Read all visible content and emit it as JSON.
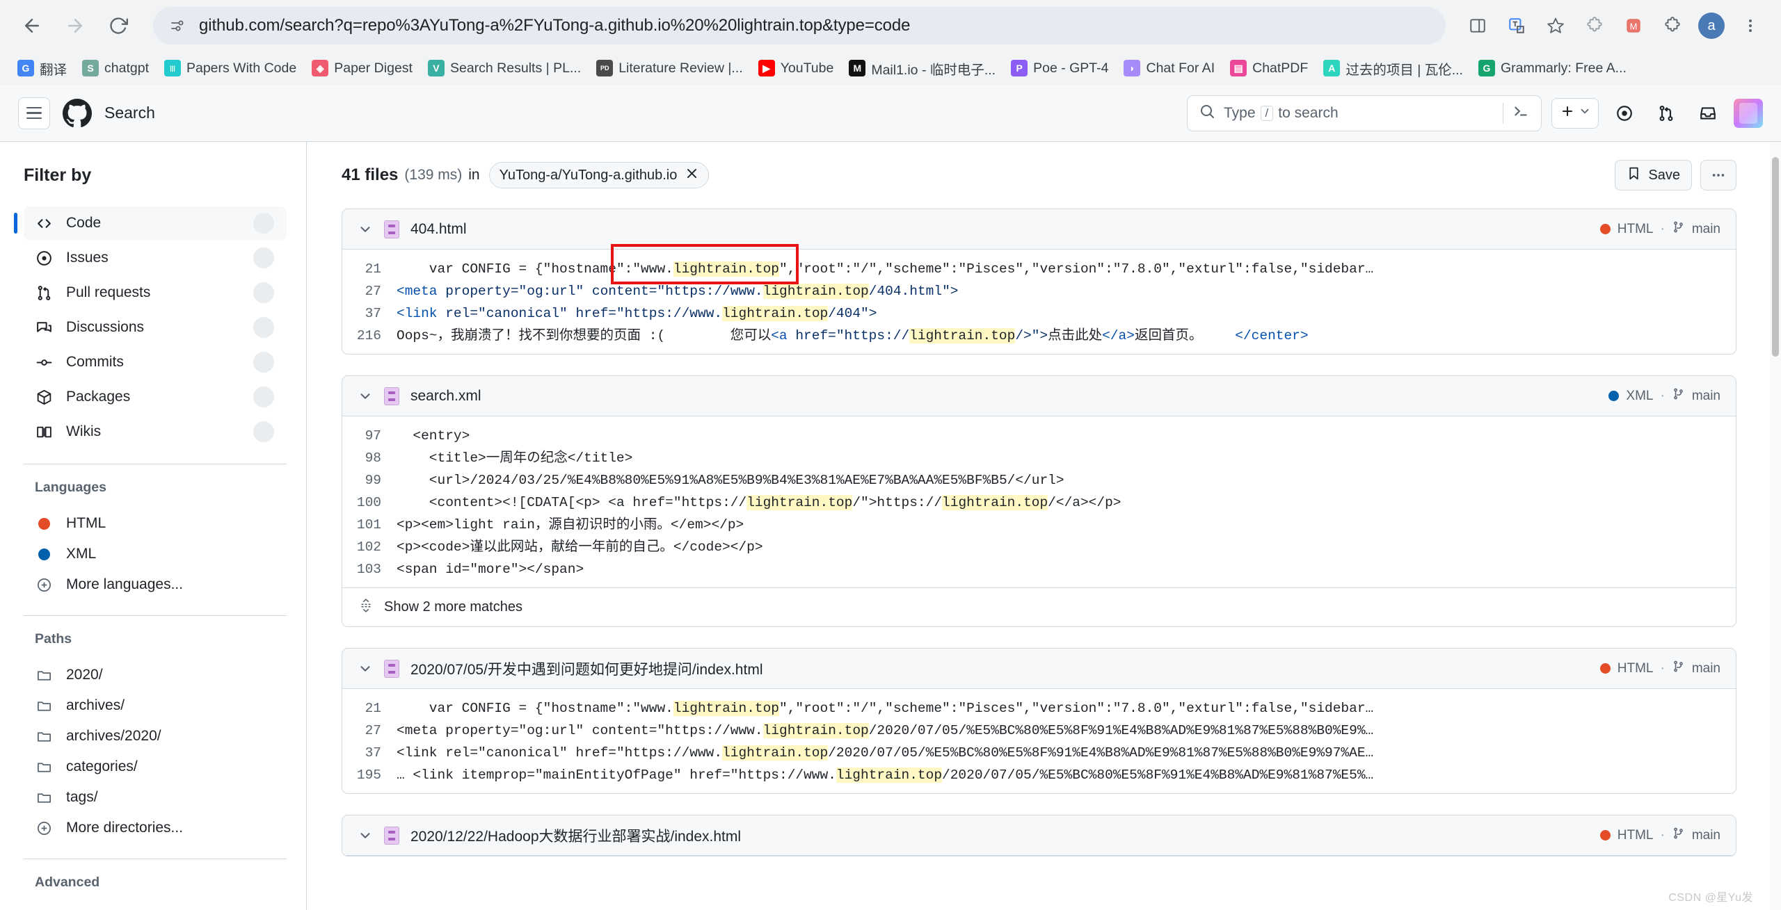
{
  "browser": {
    "url": "github.com/search?q=repo%3AYuTong-a%2FYuTong-a.github.io%20%20lightrain.top&type=code",
    "back_icon": "back-arrow-icon",
    "forward_icon": "forward-arrow-icon",
    "reload_icon": "reload-icon",
    "site_info_icon": "site-settings-icon",
    "profile_initial": "a",
    "bookmarks": [
      {
        "label": "翻译",
        "icon": "google-translate-icon",
        "color": "#4285f4",
        "glyph": "G"
      },
      {
        "label": "chatgpt",
        "icon": "chatgpt-icon",
        "color": "#74aa9c",
        "glyph": "S"
      },
      {
        "label": "Papers With Code",
        "icon": "papers-with-code-icon",
        "color": "#21cbce",
        "glyph": "|||"
      },
      {
        "label": "Paper Digest",
        "icon": "paper-digest-icon",
        "color": "#ef5a6f",
        "glyph": "◈"
      },
      {
        "label": "Search Results | PL...",
        "icon": "search-results-icon",
        "color": "#3ab0a2",
        "glyph": "V"
      },
      {
        "label": "Literature Review |...",
        "icon": "literature-review-icon",
        "color": "#4a4a4a",
        "glyph": "PD"
      },
      {
        "label": "YouTube",
        "icon": "youtube-icon",
        "color": "#ff0000",
        "glyph": "▶"
      },
      {
        "label": "Mail1.io - 临时电子...",
        "icon": "mail1-icon",
        "color": "#111111",
        "glyph": "M"
      },
      {
        "label": "Poe - GPT-4",
        "icon": "poe-icon",
        "color": "#8b5cf6",
        "glyph": "P"
      },
      {
        "label": "Chat For AI",
        "icon": "chat-for-ai-icon",
        "color": "#a78bfa",
        "glyph": "◗"
      },
      {
        "label": "ChatPDF",
        "icon": "chatpdf-icon",
        "color": "#ec4899",
        "glyph": "▤"
      },
      {
        "label": "过去的项目 | 瓦伦...",
        "icon": "past-projects-icon",
        "color": "#2dd4bf",
        "glyph": "A"
      },
      {
        "label": "Grammarly: Free A...",
        "icon": "grammarly-icon",
        "color": "#15a46e",
        "glyph": "G"
      }
    ]
  },
  "gh_header": {
    "title": "Search",
    "search_placeholder_pre": "Type",
    "search_key": "/",
    "search_placeholder_post": "to search",
    "menu_icon": "hamburger-menu-icon",
    "logo_icon": "github-logo-icon",
    "command_palette_icon": "command-palette-icon",
    "create_new_icon": "plus-icon",
    "issues_icon": "issues-icon",
    "pull_requests_icon": "pull-request-icon",
    "notifications_icon": "inbox-icon",
    "avatar_icon": "user-avatar"
  },
  "sidebar": {
    "title": "Filter by",
    "items": [
      {
        "label": "Code",
        "icon": "code-icon",
        "active": true
      },
      {
        "label": "Issues",
        "icon": "issue-opened-icon",
        "active": false
      },
      {
        "label": "Pull requests",
        "icon": "git-pull-request-icon",
        "active": false
      },
      {
        "label": "Discussions",
        "icon": "comment-discussion-icon",
        "active": false
      },
      {
        "label": "Commits",
        "icon": "git-commit-icon",
        "active": false
      },
      {
        "label": "Packages",
        "icon": "package-icon",
        "active": false
      },
      {
        "label": "Wikis",
        "icon": "book-icon",
        "active": false
      }
    ],
    "languages_heading": "Languages",
    "languages": [
      {
        "label": "HTML",
        "color": "#e34c26"
      },
      {
        "label": "XML",
        "color": "#0060ac"
      }
    ],
    "more_languages": "More languages...",
    "paths_heading": "Paths",
    "paths": [
      {
        "label": "2020/"
      },
      {
        "label": "archives/"
      },
      {
        "label": "archives/2020/"
      },
      {
        "label": "categories/"
      },
      {
        "label": "tags/"
      }
    ],
    "more_directories": "More directories...",
    "advanced_heading": "Advanced"
  },
  "results": {
    "count_label": "41 files",
    "time_label": "(139 ms)",
    "in_label": "in",
    "repo_chip": "YuTong-a/YuTong-a.github.io",
    "repo_chip_remove_icon": "close-icon",
    "save_label": "Save",
    "save_icon": "bookmark-icon",
    "more_actions_icon": "kebab-icon",
    "cards": [
      {
        "file_name": "404.html",
        "file_icon": "html-file-icon",
        "language": "HTML",
        "language_color": "#e34c26",
        "branch": "main",
        "branch_icon": "git-branch-icon",
        "chevron_icon": "chevron-down-icon",
        "lines": [
          {
            "num": "21",
            "segments": [
              {
                "t": "    var CONFIG = {\"hostname\":\"www.",
                "c": "plain"
              },
              {
                "t": "lightrain.top",
                "c": "hl"
              },
              {
                "t": "\",\"root\":\"/\",\"scheme\":\"Pisces\",\"version\":\"7.8.0\",\"exturl\":false,\"sidebar…",
                "c": "plain"
              }
            ]
          },
          {
            "num": "27",
            "segments": [
              {
                "t": "<meta ",
                "c": "tag"
              },
              {
                "t": "property=",
                "c": "attr"
              },
              {
                "t": "\"og:url\" ",
                "c": "str"
              },
              {
                "t": "content=",
                "c": "attr"
              },
              {
                "t": "\"https://www.",
                "c": "str"
              },
              {
                "t": "lightrain.top",
                "c": "hl"
              },
              {
                "t": "/404.html\">",
                "c": "str"
              }
            ]
          },
          {
            "num": "37",
            "segments": [
              {
                "t": "<link ",
                "c": "tag"
              },
              {
                "t": "rel=",
                "c": "attr"
              },
              {
                "t": "\"canonical\" ",
                "c": "str"
              },
              {
                "t": "href=",
                "c": "attr"
              },
              {
                "t": "\"https://www.",
                "c": "str"
              },
              {
                "t": "lightrain.top",
                "c": "hl"
              },
              {
                "t": "/404\">",
                "c": "str"
              }
            ]
          },
          {
            "num": "216",
            "segments": [
              {
                "t": "Oops~，我崩溃了！找不到你想要的页面 :(        您可以",
                "c": "plain"
              },
              {
                "t": "<a ",
                "c": "tag"
              },
              {
                "t": "href=",
                "c": "attr"
              },
              {
                "t": "\"https://",
                "c": "str"
              },
              {
                "t": "lightrain.top",
                "c": "hl"
              },
              {
                "t": "/>\">",
                "c": "str"
              },
              {
                "t": "点击此处",
                "c": "plain"
              },
              {
                "t": "</a>",
                "c": "tag"
              },
              {
                "t": "返回首页。    ",
                "c": "plain"
              },
              {
                "t": "</center>",
                "c": "tag"
              }
            ]
          }
        ],
        "show_more": null
      },
      {
        "file_name": "search.xml",
        "file_icon": "xml-file-icon",
        "language": "XML",
        "language_color": "#0060ac",
        "branch": "main",
        "branch_icon": "git-branch-icon",
        "chevron_icon": "chevron-down-icon",
        "lines": [
          {
            "num": "97",
            "segments": [
              {
                "t": "  <entry>",
                "c": "plain"
              }
            ]
          },
          {
            "num": "98",
            "segments": [
              {
                "t": "    <title>一周年の纪念</title>",
                "c": "plain"
              }
            ]
          },
          {
            "num": "99",
            "segments": [
              {
                "t": "    <url>/2024/03/25/%E4%B8%80%E5%91%A8%E5%B9%B4%E3%81%AE%E7%BA%AA%E5%BF%B5/</url>",
                "c": "plain"
              }
            ]
          },
          {
            "num": "100",
            "segments": [
              {
                "t": "    <content><![CDATA[<p> <a href=\"https://",
                "c": "plain"
              },
              {
                "t": "lightrain.top",
                "c": "hl"
              },
              {
                "t": "/\">https://",
                "c": "plain"
              },
              {
                "t": "lightrain.top",
                "c": "hl"
              },
              {
                "t": "/</a></p>",
                "c": "plain"
              }
            ]
          },
          {
            "num": "101",
            "segments": [
              {
                "t": "<p><em>light rain，源自初识时的小雨。</em></p>",
                "c": "plain"
              }
            ]
          },
          {
            "num": "102",
            "segments": [
              {
                "t": "<p><code>谨以此网站，献给一年前的自己。</code></p>",
                "c": "plain"
              }
            ]
          },
          {
            "num": "103",
            "segments": [
              {
                "t": "<span id=\"more\"></span>",
                "c": "plain"
              }
            ]
          }
        ],
        "show_more": "Show 2 more matches",
        "show_more_icon": "unfold-icon"
      },
      {
        "file_name": "2020/07/05/开发中遇到问题如何更好地提问/index.html",
        "file_icon": "html-file-icon",
        "language": "HTML",
        "language_color": "#e34c26",
        "branch": "main",
        "branch_icon": "git-branch-icon",
        "chevron_icon": "chevron-down-icon",
        "lines": [
          {
            "num": "21",
            "segments": [
              {
                "t": "    var CONFIG = {\"hostname\":\"www.",
                "c": "plain"
              },
              {
                "t": "lightrain.top",
                "c": "hl"
              },
              {
                "t": "\",\"root\":\"/\",\"scheme\":\"Pisces\",\"version\":\"7.8.0\",\"exturl\":false,\"sidebar…",
                "c": "plain"
              }
            ]
          },
          {
            "num": "27",
            "segments": [
              {
                "t": "<meta property=\"og:url\" content=\"https://www.",
                "c": "plain"
              },
              {
                "t": "lightrain.top",
                "c": "hl"
              },
              {
                "t": "/2020/07/05/%E5%BC%80%E5%8F%91%E4%B8%AD%E9%81%87%E5%88%B0%E9%…",
                "c": "plain"
              }
            ]
          },
          {
            "num": "37",
            "segments": [
              {
                "t": "<link rel=\"canonical\" href=\"https://www.",
                "c": "plain"
              },
              {
                "t": "lightrain.top",
                "c": "hl"
              },
              {
                "t": "/2020/07/05/%E5%BC%80%E5%8F%91%E4%B8%AD%E9%81%87%E5%88%B0%E9%97%AE…",
                "c": "plain"
              }
            ]
          },
          {
            "num": "195",
            "segments": [
              {
                "t": "… <link itemprop=\"mainEntityOfPage\" href=\"https://www.",
                "c": "plain"
              },
              {
                "t": "lightrain.top",
                "c": "hl"
              },
              {
                "t": "/2020/07/05/%E5%BC%80%E5%8F%91%E4%B8%AD%E9%81%87%E5%…",
                "c": "plain"
              }
            ]
          }
        ],
        "show_more": null
      },
      {
        "file_name": "2020/12/22/Hadoop大数据行业部署实战/index.html",
        "file_icon": "html-file-icon",
        "language": "HTML",
        "language_color": "#e34c26",
        "branch": "main",
        "branch_icon": "git-branch-icon",
        "chevron_icon": "chevron-down-icon",
        "lines": [],
        "show_more": null
      }
    ]
  },
  "annotation": {
    "color": "#e81414",
    "shape": "rectangle-highlight"
  },
  "watermark": "CSDN @星Yu发"
}
